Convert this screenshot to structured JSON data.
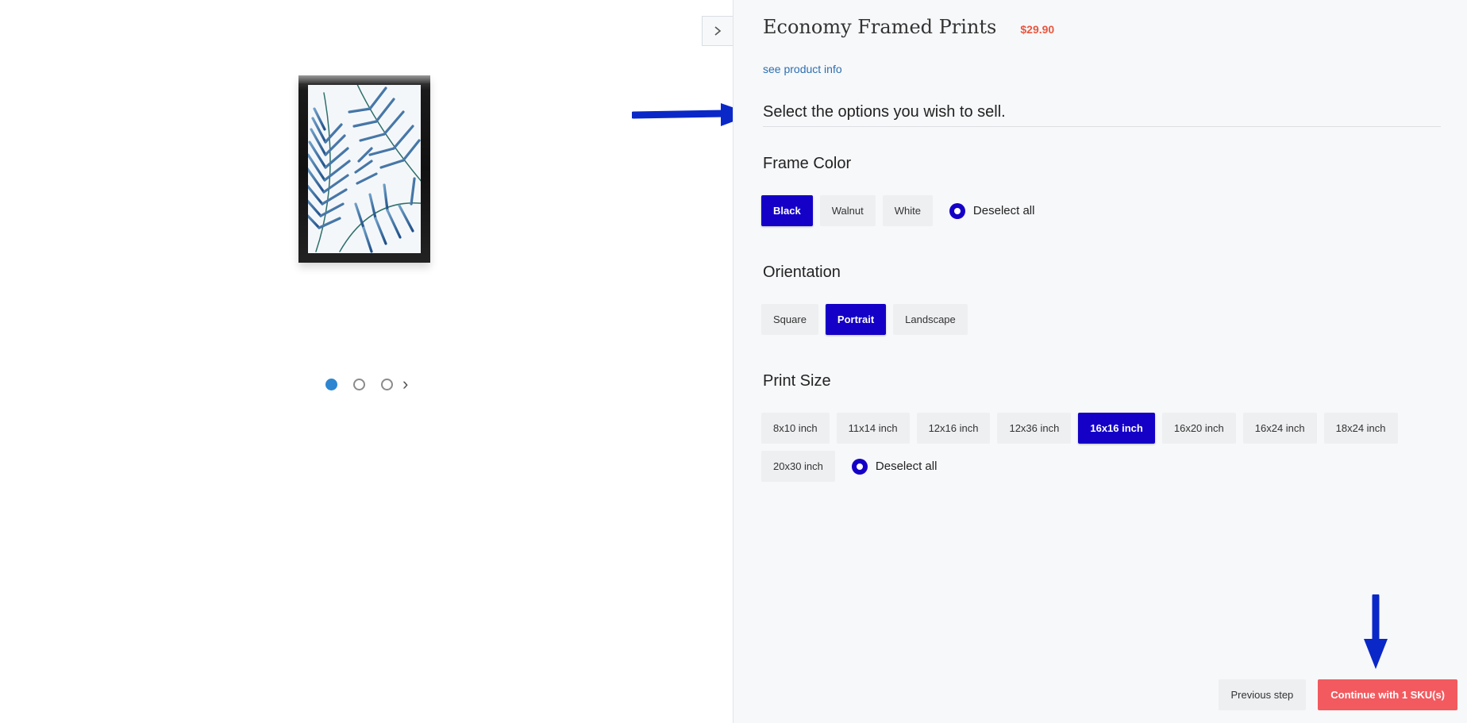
{
  "product": {
    "title": "Economy Framed Prints",
    "price": "$29.90",
    "info_link": "see product info"
  },
  "instructions": "Select the options you wish to sell.",
  "frame_color": {
    "label": "Frame Color",
    "options": [
      {
        "label": "Black",
        "selected": true
      },
      {
        "label": "Walnut",
        "selected": false
      },
      {
        "label": "White",
        "selected": false
      }
    ],
    "deselect_label": "Deselect all"
  },
  "orientation": {
    "label": "Orientation",
    "options": [
      {
        "label": "Square",
        "selected": false
      },
      {
        "label": "Portrait",
        "selected": true
      },
      {
        "label": "Landscape",
        "selected": false
      }
    ]
  },
  "print_size": {
    "label": "Print Size",
    "options": [
      {
        "label": "8x10 inch",
        "selected": false
      },
      {
        "label": "11x14 inch",
        "selected": false
      },
      {
        "label": "12x16 inch",
        "selected": false
      },
      {
        "label": "12x36 inch",
        "selected": false
      },
      {
        "label": "16x16 inch",
        "selected": true
      },
      {
        "label": "16x20 inch",
        "selected": false
      },
      {
        "label": "16x24 inch",
        "selected": false
      },
      {
        "label": "18x24 inch",
        "selected": false
      },
      {
        "label": "20x30 inch",
        "selected": false
      }
    ],
    "deselect_label": "Deselect all"
  },
  "carousel": {
    "count": 3,
    "active_index": 0
  },
  "footer": {
    "previous_label": "Previous step",
    "continue_label": "Continue with 1 SKU(s)"
  },
  "colors": {
    "accent": "#1400c6",
    "price": "#e9573f",
    "continue": "#f25a5f",
    "link": "#2d6fb0",
    "annotation_arrow": "#0a28c8"
  }
}
